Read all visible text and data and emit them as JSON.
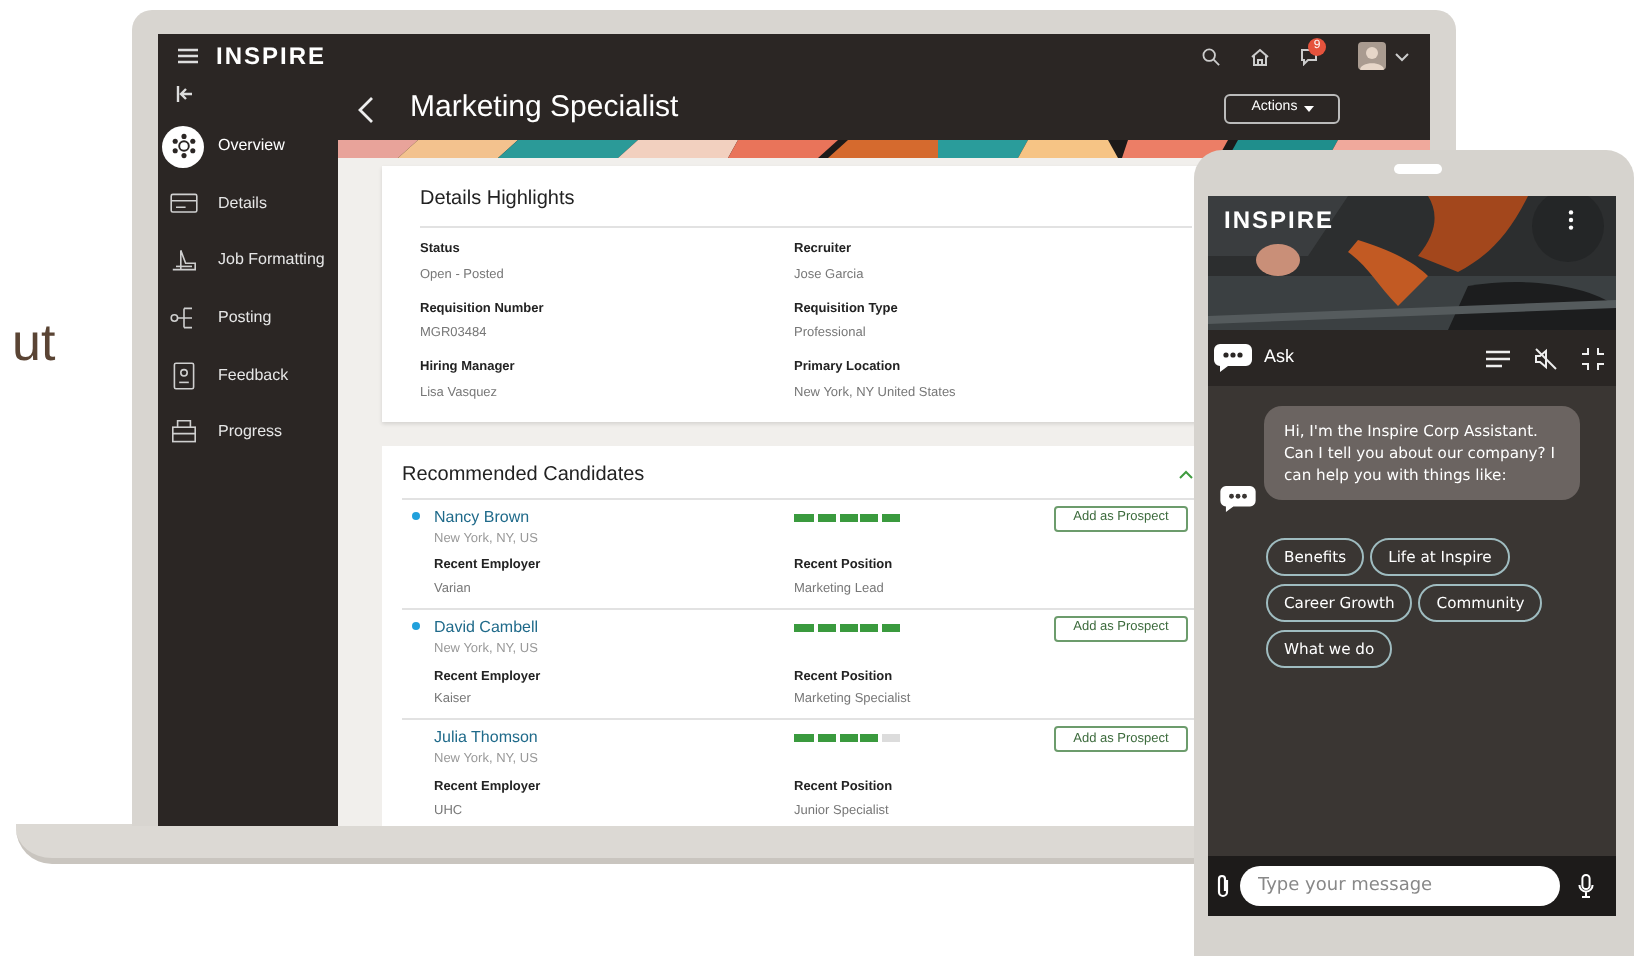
{
  "side_text": "ut",
  "laptop": {
    "app_logo": "INSPIRE",
    "notification_count": "9",
    "sidebar": [
      {
        "label": "Overview",
        "selected": true,
        "kind": "overview"
      },
      {
        "label": "Details",
        "selected": false,
        "kind": "details"
      },
      {
        "label": "Job Formatting",
        "selected": false,
        "kind": "formatting"
      },
      {
        "label": "Posting",
        "selected": false,
        "kind": "posting"
      },
      {
        "label": "Feedback",
        "selected": false,
        "kind": "feedback"
      },
      {
        "label": "Progress",
        "selected": false,
        "kind": "progress"
      }
    ],
    "page_title": "Marketing Specialist",
    "actions_button": "Actions",
    "details": {
      "title": "Details Highlights",
      "fields": [
        {
          "label": "Status",
          "value": "Open - Posted"
        },
        {
          "label": "Recruiter",
          "value": "Jose Garcia"
        },
        {
          "label": "Requisition Number",
          "value": "MGR03484"
        },
        {
          "label": "Requisition Type",
          "value": "Professional"
        },
        {
          "label": "Hiring Manager",
          "value": "Lisa Vasquez"
        },
        {
          "label": "Primary Location",
          "value": "New York, NY United States"
        }
      ]
    },
    "candidates": {
      "title": "Recommended Candidates",
      "expanded": true,
      "items": [
        {
          "name": "Nancy Brown",
          "location": "New York, NY, US",
          "new": true,
          "level": 1,
          "button": "Add as Prospect",
          "fields": [
            {
              "label": "Recent Employer",
              "value": "Varian"
            },
            {
              "label": "Recent Position",
              "value": "Marketing Lead"
            }
          ]
        },
        {
          "name": "David Cambell",
          "location": "New York, NY, US",
          "new": true,
          "level": 1,
          "button": "Add as Prospect",
          "fields": [
            {
              "label": "Recent Employer",
              "value": "Kaiser"
            },
            {
              "label": "Recent Position",
              "value": "Marketing Specialist"
            }
          ]
        },
        {
          "name": "Julia Thomson",
          "location": "New York, NY, US",
          "new": false,
          "level": 0.8,
          "button": "Add as Prospect",
          "fields": [
            {
              "label": "Recent Employer",
              "value": "UHC"
            },
            {
              "label": "Recent Position",
              "value": "Junior Specialist"
            }
          ]
        }
      ]
    }
  },
  "phone": {
    "logo": "INSPIRE",
    "chat_title": "Ask",
    "message": "Hi, I'm the Inspire Corp Assistant. Can I tell you about our company? I can help you with things like:",
    "suggestions": [
      "Benefits",
      "Life at Inspire",
      "Career Growth",
      "Community",
      "What we do"
    ],
    "input": {
      "placeholder": "Type your message"
    }
  }
}
